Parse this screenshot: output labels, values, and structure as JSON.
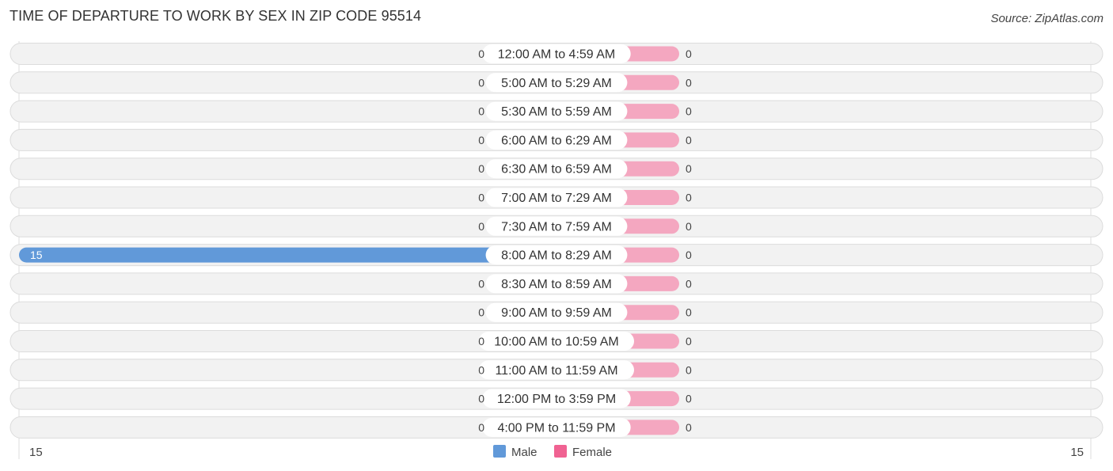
{
  "title": "TIME OF DEPARTURE TO WORK BY SEX IN ZIP CODE 95514",
  "source": "Source: ZipAtlas.com",
  "colors": {
    "male": "#a9c7ea",
    "male_highlight": "#6199d9",
    "female": "#f4a7c0",
    "legend_male": "#6199d9",
    "legend_female": "#f06292",
    "row_bg": "#f2f2f2"
  },
  "chart_data": {
    "type": "bar",
    "orientation": "horizontal-diverging",
    "title": "TIME OF DEPARTURE TO WORK BY SEX IN ZIP CODE 95514",
    "categories": [
      "12:00 AM to 4:59 AM",
      "5:00 AM to 5:29 AM",
      "5:30 AM to 5:59 AM",
      "6:00 AM to 6:29 AM",
      "6:30 AM to 6:59 AM",
      "7:00 AM to 7:29 AM",
      "7:30 AM to 7:59 AM",
      "8:00 AM to 8:29 AM",
      "8:30 AM to 8:59 AM",
      "9:00 AM to 9:59 AM",
      "10:00 AM to 10:59 AM",
      "11:00 AM to 11:59 AM",
      "12:00 PM to 3:59 PM",
      "4:00 PM to 11:59 PM"
    ],
    "series": [
      {
        "name": "Male",
        "values": [
          0,
          0,
          0,
          0,
          0,
          0,
          0,
          15,
          0,
          0,
          0,
          0,
          0,
          0
        ]
      },
      {
        "name": "Female",
        "values": [
          0,
          0,
          0,
          0,
          0,
          0,
          0,
          0,
          0,
          0,
          0,
          0,
          0,
          0
        ]
      }
    ],
    "axis": {
      "left_label": "15",
      "right_label": "15",
      "range": [
        -15,
        15
      ]
    },
    "legend": {
      "position": "bottom-center",
      "entries": [
        "Male",
        "Female"
      ]
    }
  }
}
